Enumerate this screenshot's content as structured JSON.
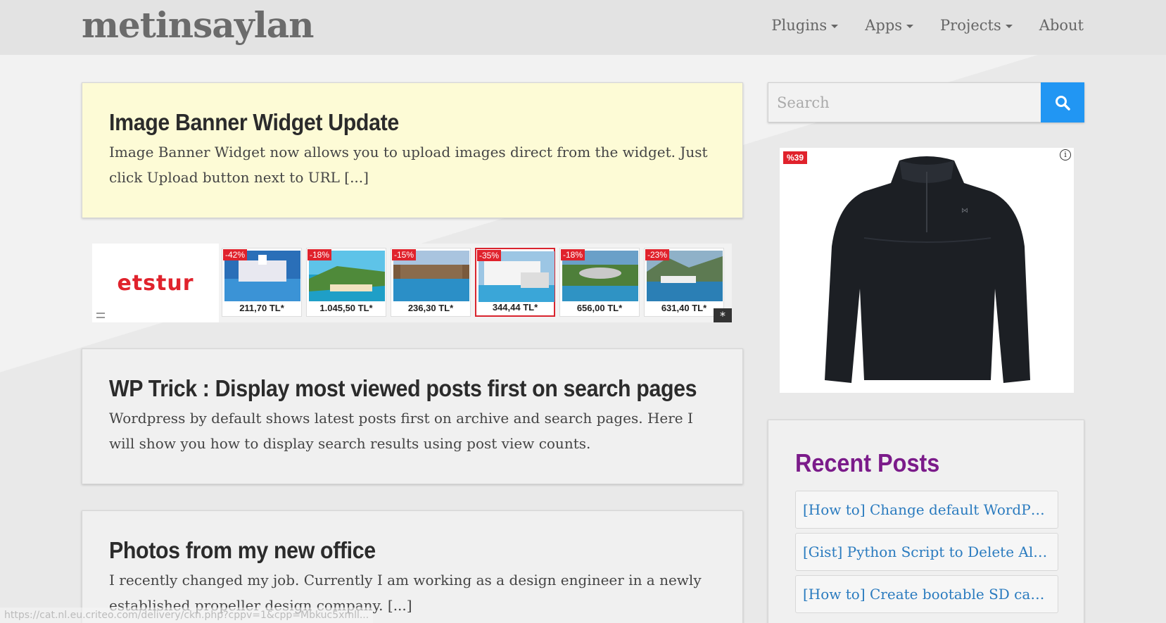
{
  "header": {
    "brand": "metinsaylan",
    "nav": [
      {
        "label": "Plugins"
      },
      {
        "label": "Apps"
      },
      {
        "label": "Projects"
      },
      {
        "label": "About"
      }
    ]
  },
  "posts": [
    {
      "title": "Image Banner Widget Update",
      "excerpt": "Image Banner Widget now allows you to upload images direct from the widget. Just click Upload button next to URL [...]"
    },
    {
      "title": "WP Trick : Display most viewed posts first on search pages",
      "excerpt": "Wordpress by default shows latest posts first on archive and search pages. Here I will show you how to display search results using post view counts."
    },
    {
      "title": "Photos from my new office",
      "excerpt": "I recently changed my job. Currently I am working as a design engineer in a newly established propeller design company. [...]"
    }
  ],
  "ad_strip": {
    "brand": "etstur",
    "tiles": [
      {
        "badge": "-42%",
        "price": "211,70 TL*"
      },
      {
        "badge": "-18%",
        "price": "1.045,50 TL*"
      },
      {
        "badge": "-15%",
        "price": "236,30 TL*"
      },
      {
        "badge": "-35%",
        "price": "344,44 TL*"
      },
      {
        "badge": "-18%",
        "price": "656,00 TL*"
      },
      {
        "badge": "-23%",
        "price": "631,40 TL*"
      }
    ],
    "star": "*"
  },
  "search": {
    "placeholder": "Search"
  },
  "side_ad": {
    "badge": "%39",
    "info": "i"
  },
  "recent_posts": {
    "title": "Recent Posts",
    "items": [
      "[How to] Change default WordPress...",
      "[Gist] Python Script to Delete All E...",
      "[How to] Create bootable SD card fo..."
    ]
  },
  "status_bar": {
    "url": "https://cat.nl.eu.criteo.com/delivery/ckn.php?cppv=1&cpp=Mbkuc5xmll..."
  },
  "colors": {
    "accent": "#2196f3",
    "recent_title": "#7b1b8a",
    "link": "#2a7bbf",
    "sticky_bg": "#fdfbd6",
    "ad_red": "#e0222c"
  }
}
